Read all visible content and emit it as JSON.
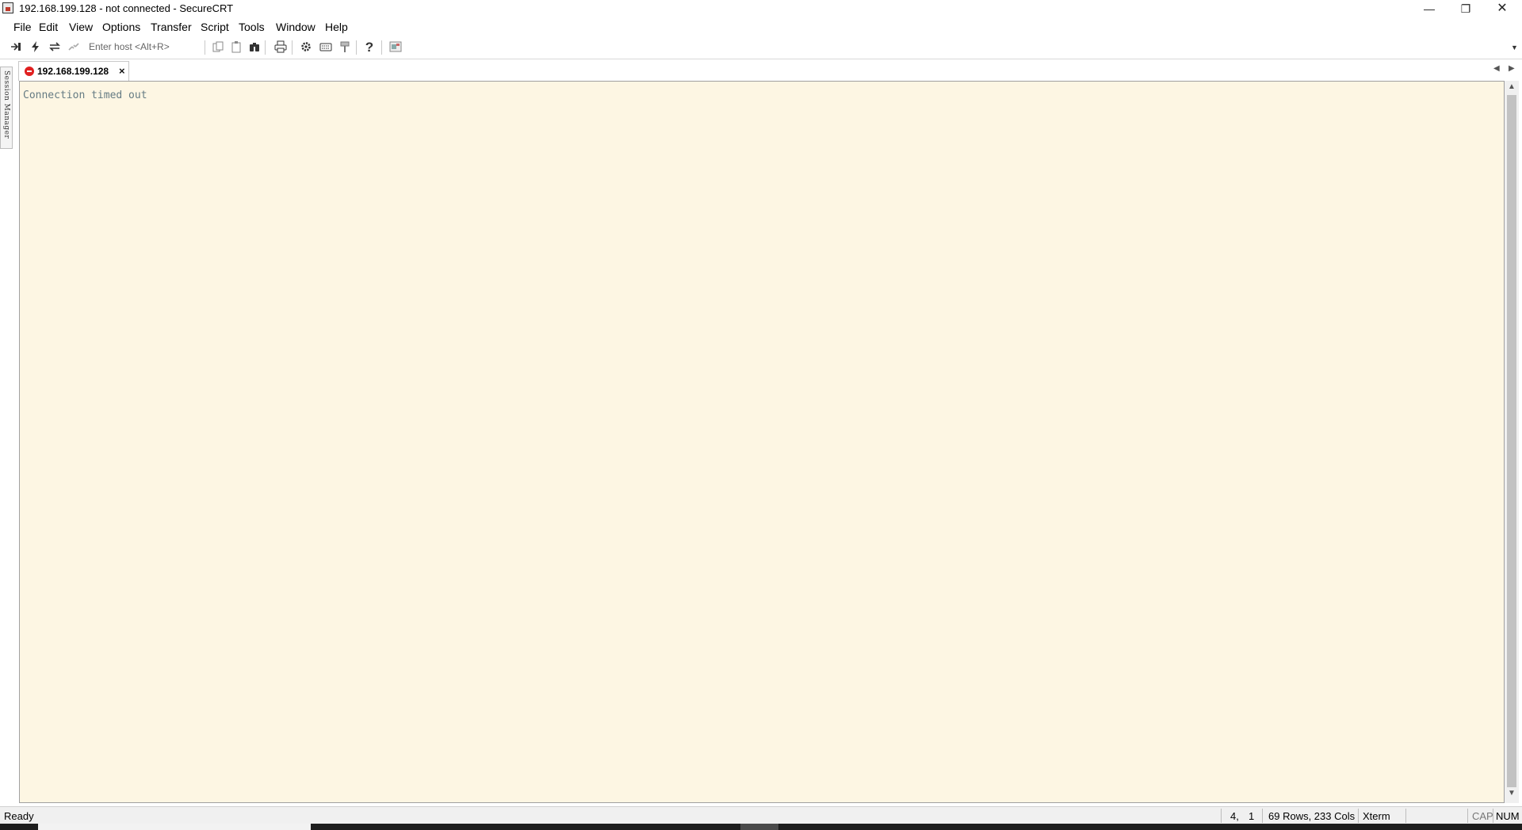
{
  "window": {
    "title": "192.168.199.128 - not connected - SecureCRT",
    "controls": {
      "minimize": "—",
      "maximize": "❐",
      "close": "✕"
    }
  },
  "menu": [
    "File",
    "Edit",
    "View",
    "Options",
    "Transfer",
    "Script",
    "Tools",
    "Window",
    "Help"
  ],
  "toolbar": {
    "host_placeholder": "Enter host <Alt+R>",
    "icons": [
      "connect-in-tab-icon",
      "quick-connect-icon",
      "reconnect-icon",
      "disconnect-icon",
      "copy-icon",
      "paste-icon",
      "find-icon",
      "print-icon",
      "session-options-icon",
      "keymap-icon",
      "sftp-icon",
      "help-icon",
      "toggle-icon"
    ]
  },
  "tabs": [
    {
      "label": "192.168.199.128",
      "status": "disconnected",
      "close": "×"
    }
  ],
  "side_panel": {
    "label": "Session Manager"
  },
  "terminal": {
    "output": "Connection timed out",
    "background": "#fdf6e3",
    "foreground": "#657b83"
  },
  "statusbar": {
    "status": "Ready",
    "cursor_row": "4,",
    "cursor_col": "1",
    "size": "69 Rows, 233 Cols",
    "emulation": "Xterm",
    "cap": "CAP",
    "num": "NUM"
  }
}
